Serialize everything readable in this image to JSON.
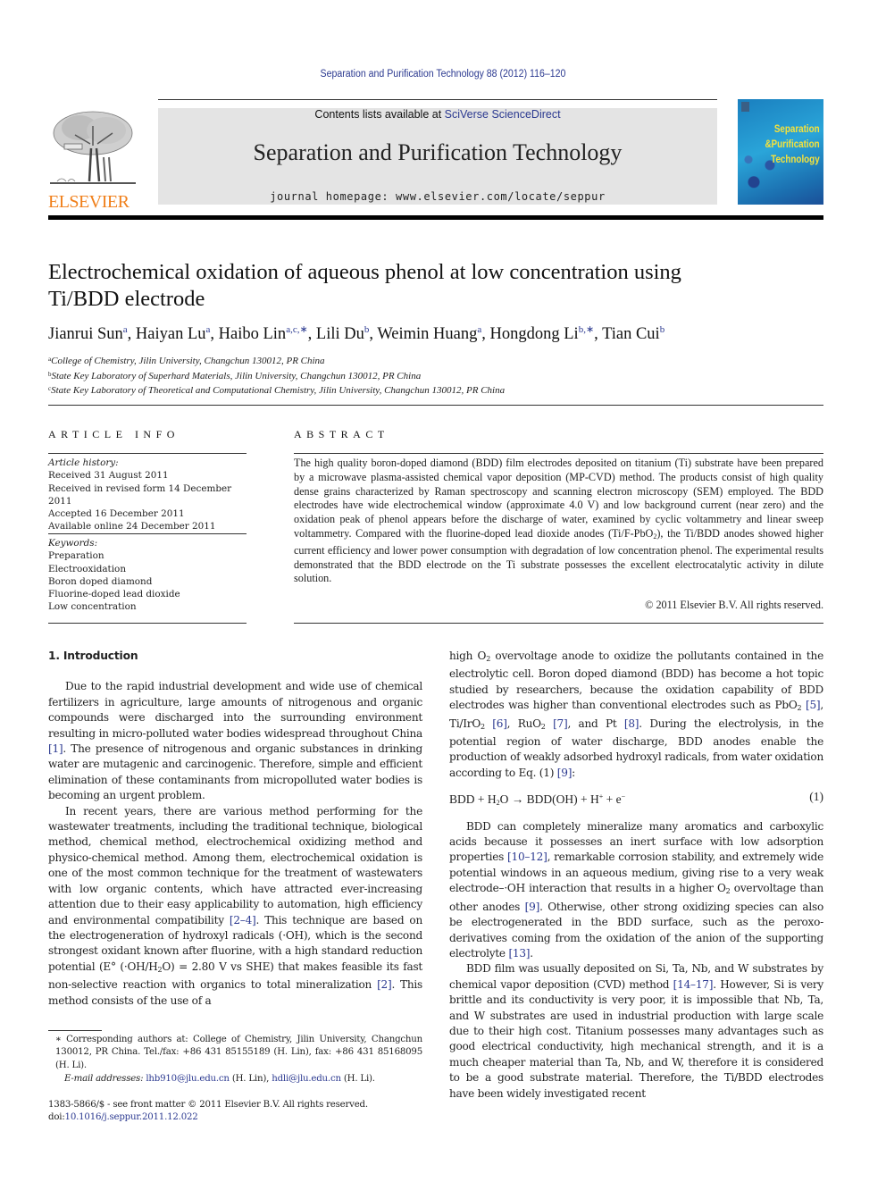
{
  "running_head": "Separation and Purification Technology 88 (2012) 116–120",
  "masthead": {
    "contents_prefix": "Contents lists available at ",
    "contents_link": "SciVerse ScienceDirect",
    "journal_title": "Separation and Purification Technology",
    "homepage": "journal homepage: www.elsevier.com/locate/seppur",
    "publisher_logo_text": "ELSEVIER",
    "cover_text": [
      "Separation",
      "&Purification",
      "Technology"
    ],
    "colors": {
      "link": "#2b3990",
      "elsevier_orange": "#f07f1a",
      "banner_bg": "#e4e4e4",
      "cover_text": "#f6e23b"
    }
  },
  "article": {
    "title_line1": "Electrochemical oxidation of aqueous phenol at low concentration using",
    "title_line2": "Ti/BDD electrode",
    "authors": [
      {
        "name": "Jianrui Sun",
        "sup": "a"
      },
      {
        "name": "Haiyan Lu",
        "sup": "a"
      },
      {
        "name": "Haibo Lin",
        "sup": "a,c,∗"
      },
      {
        "name": "Lili Du",
        "sup": "b"
      },
      {
        "name": "Weimin Huang",
        "sup": "a"
      },
      {
        "name": "Hongdong Li",
        "sup": "b,∗"
      },
      {
        "name": "Tian Cui",
        "sup": "b"
      }
    ],
    "affiliations": [
      {
        "mark": "a",
        "text": "College of Chemistry, Jilin University, Changchun 130012, PR China"
      },
      {
        "mark": "b",
        "text": "State Key Laboratory of Superhard Materials, Jilin University, Changchun 130012, PR China"
      },
      {
        "mark": "c",
        "text": "State Key Laboratory of Theoretical and Computational Chemistry, Jilin University, Changchun 130012, PR China"
      }
    ]
  },
  "article_info": {
    "heading": "ARTICLE INFO",
    "history_label": "Article history:",
    "history": [
      "Received 31 August 2011",
      "Received in revised form 14 December 2011",
      "Accepted 16 December 2011",
      "Available online 24 December 2011"
    ],
    "keywords_label": "Keywords:",
    "keywords": [
      "Preparation",
      "Electrooxidation",
      "Boron doped diamond",
      "Fluorine-doped lead dioxide",
      "Low concentration"
    ]
  },
  "abstract": {
    "heading": "ABSTRACT",
    "text_part1": "The high quality boron-doped diamond (BDD) film electrodes deposited on titanium (Ti) substrate have been prepared by a microwave plasma-assisted chemical vapor deposition (MP-CVD) method. The products consist of high quality dense grains characterized by Raman spectroscopy and scanning electron microscopy (SEM) employed. The BDD electrodes have wide electrochemical window (approximate 4.0 V) and low background current (near zero) and the oxidation peak of phenol appears before the discharge of water, examined by cyclic voltammetry and linear sweep voltammetry. Compared with the fluorine-doped lead dioxide anodes (Ti/F-PbO",
    "text_sub": "2",
    "text_part2": "), the Ti/BDD anodes showed higher current efficiency and lower power consumption with degradation of low concentration phenol. The experimental results demonstrated that the BDD electrode on the Ti substrate possesses the excellent electrocatalytic activity in dilute solution.",
    "copyright": "© 2011 Elsevier B.V. All rights reserved."
  },
  "body": {
    "section_heading": "1. Introduction",
    "p1": {
      "a": "Due to the rapid industrial development and wide use of chemical fertilizers in agriculture, large amounts of nitrogenous and organic compounds were discharged into the surrounding environment resulting in micro-polluted water bodies widespread throughout China ",
      "ref1": "[1]",
      "b": ". The presence of nitrogenous and organic substances in drinking water are mutagenic and carcinogenic. Therefore, simple and efficient elimination of these contaminants from micropolluted water bodies is becoming an urgent problem."
    },
    "p2": {
      "a": "In recent years, there are various method performing for the wastewater treatments, including the traditional technique, biological method, chemical method, electrochemical oxidizing method and physico-chemical method. Among them, electrochemical oxidation is one of the most common technique for the treatment of wastewaters with low organic contents, which have attracted ever-increasing attention due to their easy applicability to automation, high efficiency and environmental compatibility ",
      "ref1": "[2–4]",
      "b": ". This technique are based on the electrogeneration of hydroxyl radicals (·OH), which is the second strongest oxidant known after fluorine, with a high standard reduction potential (E° (·OH/H",
      "sub": "2",
      "c": "O) = 2.80 V vs SHE) that makes feasible its fast non-selective reaction with organics to total mineralization ",
      "ref2": "[2]",
      "d": ". This method consists of the use of a"
    },
    "p3": {
      "a": "high O",
      "sub1": "2",
      "b": " overvoltage anode to oxidize the pollutants contained in the electrolytic cell. Boron doped diamond (BDD) has become a hot topic studied by researchers, because the oxidation capability of BDD electrodes was higher than conventional electrodes such as PbO",
      "sub2": "2",
      "ref5": "[5]",
      "c": ", Ti/IrO",
      "sub3": "2",
      "ref6": "[6]",
      "d": ", RuO",
      "sub4": "2",
      "ref7": "[7]",
      "e": ", and Pt ",
      "ref8": "[8]",
      "f": ". During the electrolysis, in the potential region of water discharge, BDD anodes enable the production of weakly adsorbed hydroxyl radicals, from water oxidation according to Eq. (1) ",
      "ref9": "[9]",
      "g": ":"
    },
    "equation": {
      "lhs_a": "BDD + H",
      "lhs_sub": "2",
      "lhs_b": "O → BDD(OH) + H",
      "sup1": "+",
      "lhs_c": " + e",
      "sup2": "−",
      "number": "(1)"
    },
    "p4": {
      "a": "BDD can completely mineralize many aromatics and carboxylic acids because it possesses an inert surface with low adsorption properties ",
      "ref1": "[10–12]",
      "b": ", remarkable corrosion stability, and extremely wide potential windows in an aqueous medium, giving rise to a very weak electrode–·OH interaction that results in a higher O",
      "sub": "2",
      "c": " overvoltage than other anodes ",
      "ref2": "[9]",
      "d": ". Otherwise, other strong oxidizing species can also be electrogenerated in the BDD surface, such as the peroxo-derivatives coming from the oxidation of the anion of the supporting electrolyte ",
      "ref3": "[13]",
      "e": "."
    },
    "p5": {
      "a": "BDD film was usually deposited on Si, Ta, Nb, and W substrates by chemical vapor deposition (CVD) method ",
      "ref1": "[14–17]",
      "b": ". However, Si is very brittle and its conductivity is very poor, it is impossible that Nb, Ta, and W substrates are used in industrial production with large scale due to their high cost. Titanium possesses many advantages such as good electrical conductivity, high mechanical strength, and it is a much cheaper material than Ta, Nb, and W, therefore it is considered to be a good substrate material. Therefore, the Ti/BDD electrodes have been widely investigated recent"
    }
  },
  "footnotes": {
    "corresponding": "∗ Corresponding authors at: College of Chemistry, Jilin University, Changchun 130012, PR China. Tel./fax: +86 431 85155189 (H. Lin), fax: +86 431 85168095 (H. Li).",
    "email_label": "E-mail addresses:",
    "email1": "lhb910@jlu.edu.cn",
    "email1_who": " (H. Lin), ",
    "email2": "hdli@jlu.edu.cn",
    "email2_who": " (H. Li).",
    "issn_line": "1383-5866/$ - see front matter © 2011 Elsevier B.V. All rights reserved.",
    "doi_prefix": "doi:",
    "doi": "10.1016/j.seppur.2011.12.022"
  }
}
